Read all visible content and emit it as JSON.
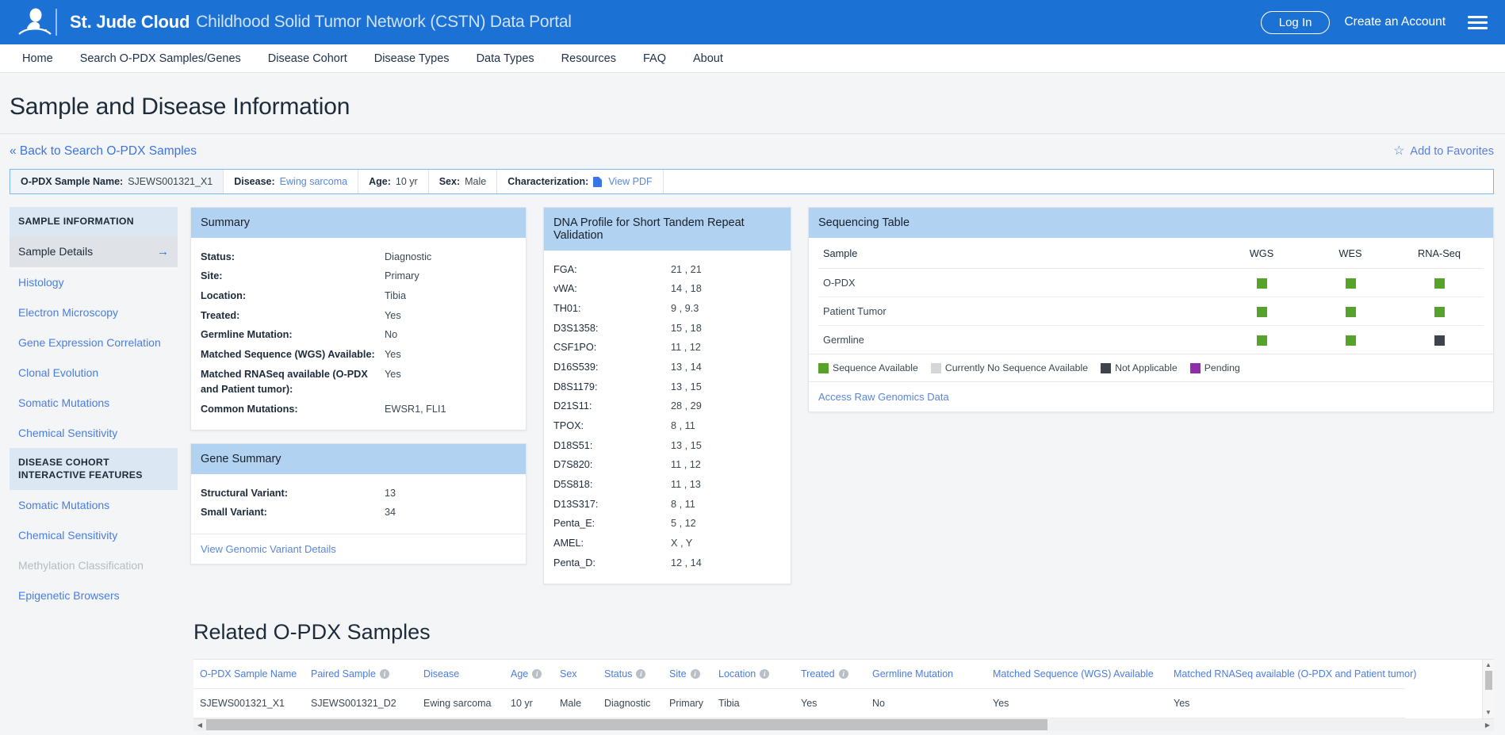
{
  "header": {
    "brand_strong": "St. Jude Cloud",
    "brand_light": "Childhood Solid Tumor Network (CSTN) Data Portal",
    "login_label": "Log In",
    "create_account_label": "Create an Account",
    "accent_blue": "#1b72d4"
  },
  "nav": {
    "items": [
      {
        "label": "Home"
      },
      {
        "label": "Search O-PDX Samples/Genes"
      },
      {
        "label": "Disease Cohort"
      },
      {
        "label": "Disease Types"
      },
      {
        "label": "Data Types"
      },
      {
        "label": "Resources"
      },
      {
        "label": "FAQ"
      },
      {
        "label": "About"
      }
    ]
  },
  "page": {
    "title": "Sample and Disease Information",
    "back_link": "« Back to Search O-PDX Samples",
    "favorites_label": "Add to Favorites"
  },
  "infobar": {
    "sample_name_key": "O-PDX Sample Name:",
    "sample_name_value": "SJEWS001321_X1",
    "disease_key": "Disease:",
    "disease_value": "Ewing sarcoma",
    "age_key": "Age:",
    "age_value": "10 yr",
    "sex_key": "Sex:",
    "sex_value": "Male",
    "characterization_key": "Characterization:",
    "characterization_value": "View PDF"
  },
  "sidebar": {
    "section1_title": "SAMPLE INFORMATION",
    "section1_items": [
      {
        "label": "Sample Details",
        "active": true
      },
      {
        "label": "Histology"
      },
      {
        "label": "Electron Microscopy"
      },
      {
        "label": "Gene Expression Correlation"
      },
      {
        "label": "Clonal Evolution"
      },
      {
        "label": "Somatic Mutations"
      },
      {
        "label": "Chemical Sensitivity"
      }
    ],
    "section2_title": "DISEASE COHORT INTERACTIVE FEATURES",
    "section2_items": [
      {
        "label": "Somatic Mutations"
      },
      {
        "label": "Chemical Sensitivity"
      },
      {
        "label": "Methylation Classification",
        "disabled": true
      },
      {
        "label": "Epigenetic Browsers"
      }
    ]
  },
  "summary": {
    "title": "Summary",
    "rows": [
      {
        "key": "Status:",
        "value": "Diagnostic"
      },
      {
        "key": "Site:",
        "value": "Primary"
      },
      {
        "key": "Location:",
        "value": "Tibia"
      },
      {
        "key": "Treated:",
        "value": "Yes"
      },
      {
        "key": "Germline Mutation:",
        "value": "No"
      },
      {
        "key": "Matched Sequence (WGS) Available:",
        "value": "Yes"
      },
      {
        "key": "Matched RNASeq available (O-PDX and Patient tumor):",
        "value": "Yes"
      },
      {
        "key": "Common Mutations:",
        "value": "EWSR1, FLI1"
      }
    ]
  },
  "gene_summary": {
    "title": "Gene Summary",
    "rows": [
      {
        "key": "Structural Variant:",
        "value": "13"
      },
      {
        "key": "Small Variant:",
        "value": "34"
      }
    ],
    "link": "View Genomic Variant Details"
  },
  "dna_profile": {
    "title": "DNA Profile for Short Tandem Repeat Validation",
    "rows": [
      {
        "key": "FGA:",
        "value": "21 , 21"
      },
      {
        "key": "vWA:",
        "value": "14 , 18"
      },
      {
        "key": "TH01:",
        "value": "9 , 9.3"
      },
      {
        "key": "D3S1358:",
        "value": "15 , 18"
      },
      {
        "key": "CSF1PO:",
        "value": "11 , 12"
      },
      {
        "key": "D16S539:",
        "value": "13 , 14"
      },
      {
        "key": "D8S1179:",
        "value": "13 , 15"
      },
      {
        "key": "D21S11:",
        "value": "28 , 29"
      },
      {
        "key": "TPOX:",
        "value": "8 , 11"
      },
      {
        "key": "D18S51:",
        "value": "13 , 15"
      },
      {
        "key": "D7S820:",
        "value": "11 , 12"
      },
      {
        "key": "D5S818:",
        "value": "11 , 13"
      },
      {
        "key": "D13S317:",
        "value": "8 , 11"
      },
      {
        "key": "Penta_E:",
        "value": "5 , 12"
      },
      {
        "key": "AMEL:",
        "value": "X , Y"
      },
      {
        "key": "Penta_D:",
        "value": "12 , 14"
      }
    ]
  },
  "sequencing": {
    "title": "Sequencing Table",
    "columns": [
      "Sample",
      "WGS",
      "WES",
      "RNA-Seq"
    ],
    "rows": [
      {
        "sample": "O-PDX",
        "wgs": "available",
        "wes": "available",
        "rnaseq": "available"
      },
      {
        "sample": "Patient Tumor",
        "wgs": "available",
        "wes": "available",
        "rnaseq": "available"
      },
      {
        "sample": "Germline",
        "wgs": "available",
        "wes": "available",
        "rnaseq": "not_applicable"
      }
    ],
    "legend": [
      {
        "label": "Sequence Available",
        "color": "#57a22a"
      },
      {
        "label": "Currently No Sequence Available",
        "color": "#d3d7da"
      },
      {
        "label": "Not Applicable",
        "color": "#3d444b"
      },
      {
        "label": "Pending",
        "color": "#8f2ea8"
      }
    ],
    "status_colors": {
      "available": "#57a22a",
      "none": "#d3d7da",
      "not_applicable": "#3d444b",
      "pending": "#8f2ea8"
    },
    "link": "Access Raw Genomics Data"
  },
  "related": {
    "title": "Related O-PDX Samples",
    "columns": [
      {
        "label": "O-PDX Sample Name",
        "info": false
      },
      {
        "label": "Paired Sample",
        "info": true
      },
      {
        "label": "Disease",
        "info": false
      },
      {
        "label": "Age",
        "info": true
      },
      {
        "label": "Sex",
        "info": false
      },
      {
        "label": "Status",
        "info": true
      },
      {
        "label": "Site",
        "info": true
      },
      {
        "label": "Location",
        "info": true
      },
      {
        "label": "Treated",
        "info": true
      },
      {
        "label": "Germline Mutation",
        "info": false
      },
      {
        "label": "Matched Sequence (WGS) Available",
        "info": false
      },
      {
        "label": "Matched RNASeq available (O-PDX and Patient tumor)",
        "info": false
      }
    ],
    "rows": [
      [
        "SJEWS001321_X1",
        "SJEWS001321_D2",
        "Ewing sarcoma",
        "10 yr",
        "Male",
        "Diagnostic",
        "Primary",
        "Tibia",
        "Yes",
        "No",
        "Yes",
        "Yes"
      ]
    ]
  }
}
